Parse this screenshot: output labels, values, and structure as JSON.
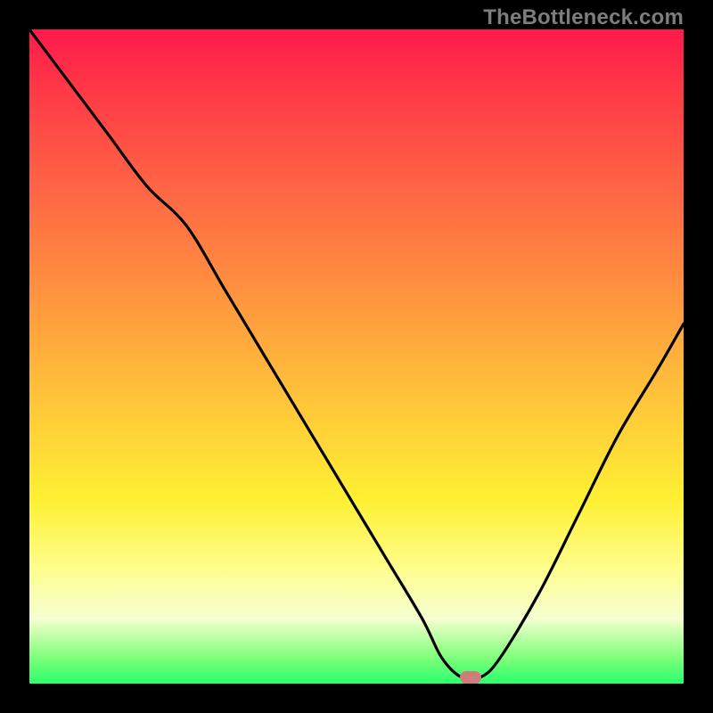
{
  "watermark": "TheBottleneck.com",
  "marker": {
    "cx_pct": 67.5,
    "cy_pct": 99.0
  },
  "colors": {
    "curve_stroke": "#000000",
    "marker_fill": "#cf7d7b",
    "background": "#000000",
    "gradient_stops": [
      "#ff1a4b",
      "#ff3b46",
      "#ff6744",
      "#ff8c40",
      "#ffb13c",
      "#ffd438",
      "#fff033",
      "#fffd8a",
      "#f6ffd0",
      "#7fff7a",
      "#2bff6d"
    ]
  },
  "chart_data": {
    "type": "line",
    "title": "",
    "xlabel": "",
    "ylabel": "",
    "xlim": [
      0,
      100
    ],
    "ylim": [
      0,
      100
    ],
    "x": [
      0,
      6,
      12,
      18,
      24,
      30,
      36,
      42,
      48,
      54,
      60,
      63,
      66,
      69,
      72,
      78,
      84,
      90,
      96,
      100
    ],
    "values": [
      100,
      92,
      84,
      76,
      70,
      60,
      50,
      40,
      30,
      20,
      10,
      4,
      1,
      1,
      4,
      14,
      26,
      38,
      48,
      55
    ],
    "note": "x and values are percentages of plot width/height; values represent height of the black curve above the bottom (0 = bottom green band, 100 = top of gradient). Chart has no visible axis ticks or numeric labels; gradient encodes severity (red high → green low)."
  }
}
